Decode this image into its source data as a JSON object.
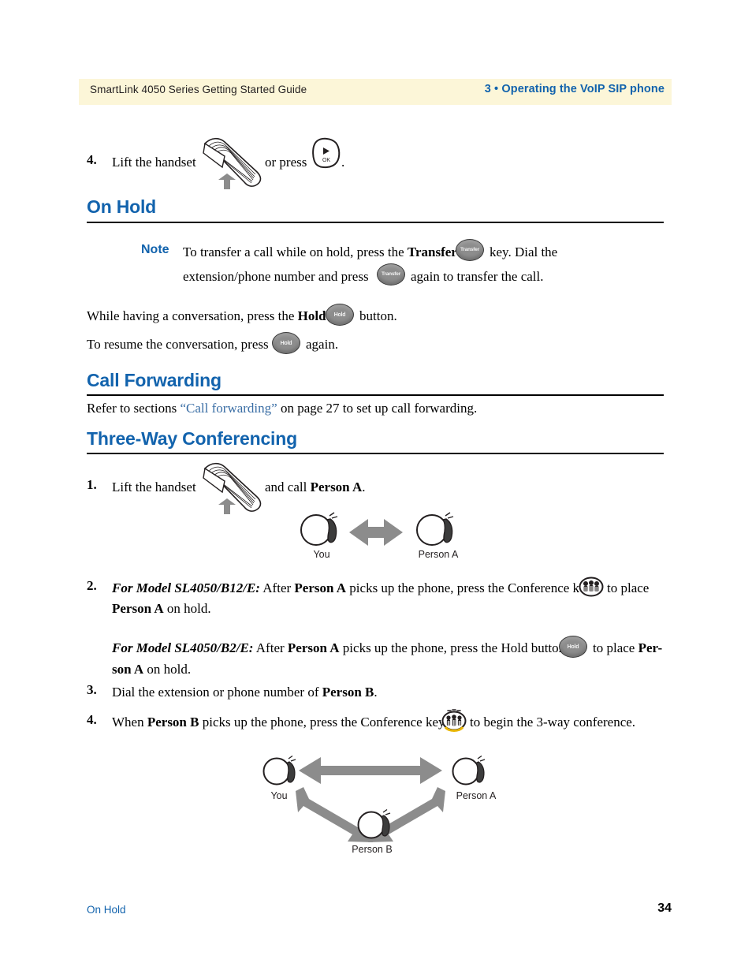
{
  "page": {
    "header": {
      "left_title": "SmartLink 4050 Series Getting Started Guide",
      "right_title": "3 • Operating the VoIP SIP phone",
      "band_color": "#fcf6d8",
      "accent_color": "#1263ad"
    },
    "footer": {
      "left_label": "On Hold",
      "page_number": "34"
    }
  },
  "step_4_top": {
    "number": "4.",
    "text_before": "Lift the handset",
    "text_middle": "or press",
    "text_after": ".",
    "ok_key_label": "OK"
  },
  "on_hold": {
    "heading": "On Hold",
    "note_label": "Note",
    "note_line1_a": "To transfer a call while on hold, press the ",
    "note_line1_bold": "Transfer",
    "note_line1_b": " key. Dial the",
    "note_line2_a": "extension/phone number and press",
    "note_line2_b": "again to transfer the call.",
    "para1_a": "While having a conversation, press the ",
    "para1_bold": "Hold",
    "para1_b": " button.",
    "para2_a": "To resume the conversation, press",
    "para2_b": "again.",
    "transfer_key_label": "Transfer",
    "hold_key_label": "Hold"
  },
  "call_forwarding": {
    "heading": "Call Forwarding",
    "body_a": "Refer to sections ",
    "body_link": "“Call forwarding”",
    "body_b": " on page 27 to set up call forwarding."
  },
  "three_way": {
    "heading": "Three-Way Conferencing",
    "steps": [
      {
        "number": "1.",
        "text_a": "Lift the handset",
        "text_b": "and call ",
        "bold": "Person A",
        "text_c": "."
      },
      {
        "number": "2.",
        "model_1": "For Model SL4050/B12/E:",
        "line1_a": " After ",
        "line1_bold": "Person A",
        "line1_b": " picks up the phone, press the Conference key",
        "line1_c": "to place",
        "line2_bold": "Person A",
        "line2_b": " on hold.",
        "model_2": "For Model SL4050/B2/E:",
        "line3_a": " After ",
        "line3_bold": "Person A",
        "line3_b": " picks up the phone, press the Hold button",
        "line3_c": "to place ",
        "line3_bold2": "Per-",
        "line4_bold": "son A",
        "line4_b": " on hold."
      },
      {
        "number": "3.",
        "text_a": "Dial the extension or phone number of ",
        "bold": "Person B",
        "text_b": "."
      },
      {
        "number": "4.",
        "text_a": "When ",
        "bold": "Person B",
        "text_b": " picks up the phone, press the Conference key",
        "text_c": "to begin the 3-way conference."
      }
    ],
    "hold_key_label": "Hold"
  },
  "diagram_two_party": {
    "left_label": "You",
    "right_label": "Person A",
    "arrow_color": "#8c8c8c"
  },
  "diagram_three_party": {
    "top_left_label": "You",
    "top_right_label": "Person A",
    "bottom_label": "Person B",
    "arrow_color": "#8c8c8c"
  }
}
